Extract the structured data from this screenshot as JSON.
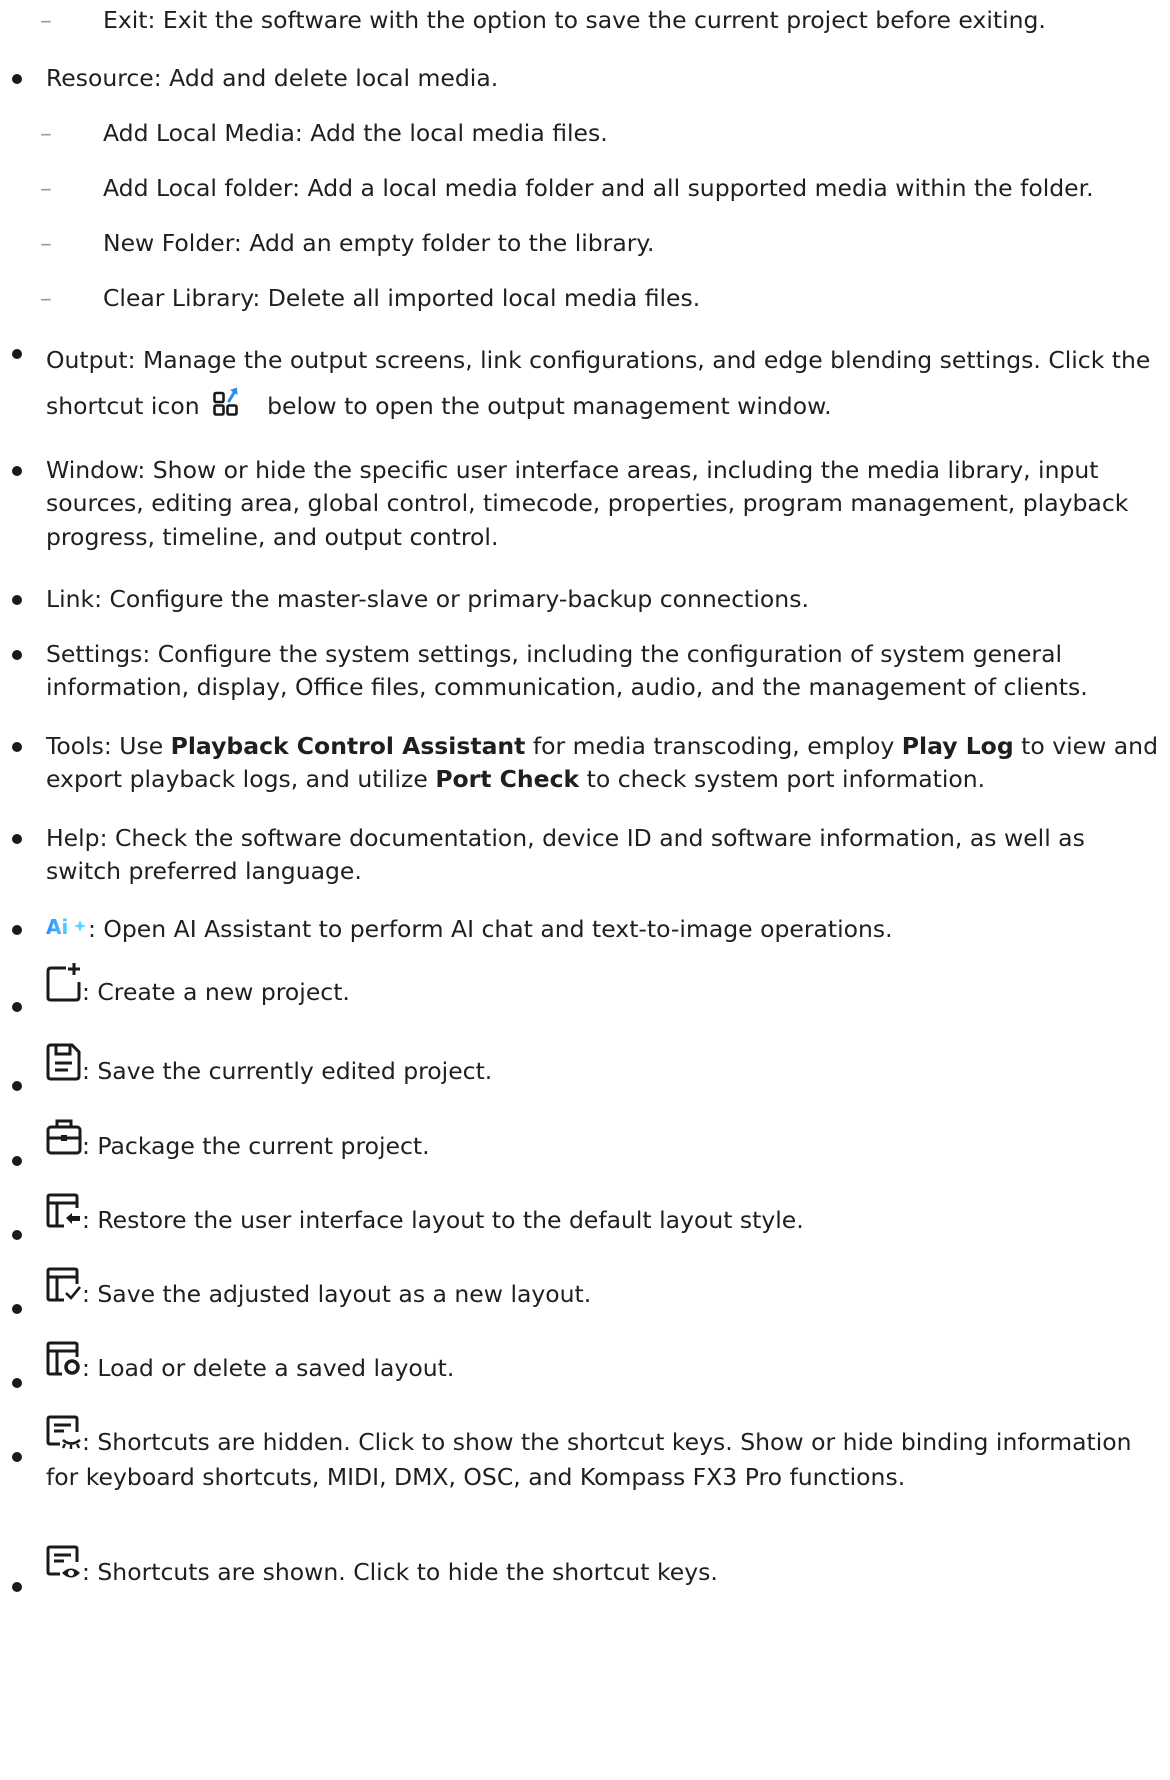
{
  "file_menu": {
    "exit": {
      "dash": "–",
      "text": "Exit: Exit the software with the option to save the current project before exiting."
    }
  },
  "resource": {
    "text": "Resource: Add and delete local media.",
    "subs": [
      {
        "dash": "–",
        "text": "Add Local Media: Add the local media files."
      },
      {
        "dash": "–",
        "text": "Add Local folder: Add a local media folder and all supported media within the folder."
      },
      {
        "dash": "–",
        "text": "New Folder: Add an empty folder to the library."
      },
      {
        "dash": "–",
        "text": "Clear Library: Delete all imported local media files."
      }
    ]
  },
  "output": {
    "a": "Output: Manage the output screens, link configurations, and edge blending settings. Click the shortcut icon",
    "b": "below to open the output management window."
  },
  "window": {
    "text": "Window: Show or hide the specific user interface areas, including the media library, input sources, editing area, global control, timecode, properties, program management, playback progress, timeline, and output control."
  },
  "link": {
    "text": "Link: Configure the master-slave or primary-backup connections."
  },
  "settings": {
    "text": "Settings: Configure the system settings, including the configuration of system general information, display, Office files, communication, audio, and the management of clients."
  },
  "tools": {
    "t1": "Tools: Use ",
    "b1": "Playback Control Assistant",
    "t2": " for media transcoding, employ ",
    "b2": "Play Log",
    "t3": " to view and export playback logs, and utilize ",
    "b3": "Port Check",
    "t4": " to check system port information."
  },
  "help": {
    "text": "Help: Check the software documentation, device ID and software information, as well as switch preferred language."
  },
  "ai": {
    "logo": "Ai",
    "text": ": Open AI Assistant to perform AI chat and text-to-image operations."
  },
  "icons": [
    {
      "icon": "new-project-icon",
      "text": ": Create a new project."
    },
    {
      "icon": "save-icon",
      "text": ": Save the currently edited project."
    },
    {
      "icon": "package-icon",
      "text": ": Package the current project."
    },
    {
      "icon": "restore-layout-icon",
      "text": ": Restore the user interface layout to the default layout style."
    },
    {
      "icon": "save-layout-icon",
      "text": ": Save the adjusted layout as a new layout."
    },
    {
      "icon": "load-layout-icon",
      "text": ": Load or delete a saved layout."
    },
    {
      "icon": "shortcuts-hidden-icon",
      "text": ": Shortcuts are hidden. Click to show the shortcut keys. Show or hide binding information for keyboard shortcuts, MIDI, DMX, OSC, and Kompass FX3 Pro functions."
    },
    {
      "icon": "shortcuts-shown-icon",
      "text": ": Shortcuts are shown. Click to hide the shortcut keys."
    }
  ],
  "colors": {
    "text": "#1f1f1f",
    "bullet": "#1a1a1a",
    "dash": "#9a9a9a",
    "accent_blue": "#2a8ee8",
    "ai_gradient_start": "#2f8cff",
    "ai_gradient_end": "#4fd2ff"
  }
}
